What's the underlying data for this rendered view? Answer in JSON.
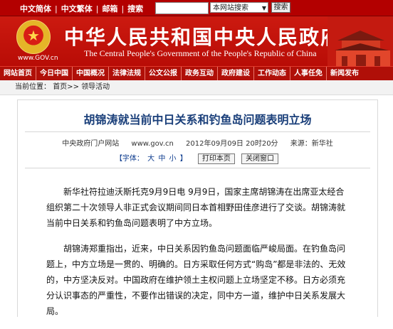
{
  "topbar": {
    "links": [
      "中文简体",
      "中文繁体",
      "邮箱",
      "搜索"
    ],
    "search_value": "",
    "scope_selected": "本网站搜索",
    "search_button": "搜索"
  },
  "banner": {
    "title_cn": "中华人民共和国中央人民政府",
    "title_en": "The Central People's Government of the People's Republic of China",
    "url": "www.GOV.cn"
  },
  "nav": {
    "items": [
      "网站首页",
      "今日中国",
      "中国概况",
      "法律法规",
      "公文公报",
      "政务互动",
      "政府建设",
      "工作动态",
      "人事任免",
      "新闻发布"
    ]
  },
  "breadcrumb": {
    "label": "当前位置：",
    "path": "首页>> 领导活动"
  },
  "article": {
    "title": "胡锦涛就当前中日关系和钓鱼岛问题表明立场",
    "source": "中央政府门户网站",
    "site": "www.gov.cn",
    "datetime": "2012年09月09日 20时20分",
    "origin": "来源：新华社",
    "font_label": "【字体：",
    "font_large": "大",
    "font_medium": "中",
    "font_small": "小",
    "font_close": "】",
    "print_button": "打印本页",
    "close_button": "关闭窗口",
    "paragraphs": [
      "新华社符拉迪沃斯托克9月9日电 9月9日，国家主席胡锦涛在出席亚太经合组织第二十次领导人非正式会议期间同日本首相野田佳彦进行了交谈。胡锦涛就当前中日关系和钓鱼岛问题表明了中方立场。",
      "胡锦涛郑重指出，近来，中日关系因钓鱼岛问题面临严峻局面。在钓鱼岛问题上，中方立场是一贯的、明确的。日方采取任何方式“购岛”都是非法的、无效的，中方坚决反对。中国政府在维护领土主权问题上立场坚定不移。日方必须充分认识事态的严重性，不要作出错误的决定，同中方一道，维护中日关系发展大局。"
    ]
  },
  "colors": {
    "brand_red": "#b30000",
    "headline_blue": "#1a3f7a"
  }
}
